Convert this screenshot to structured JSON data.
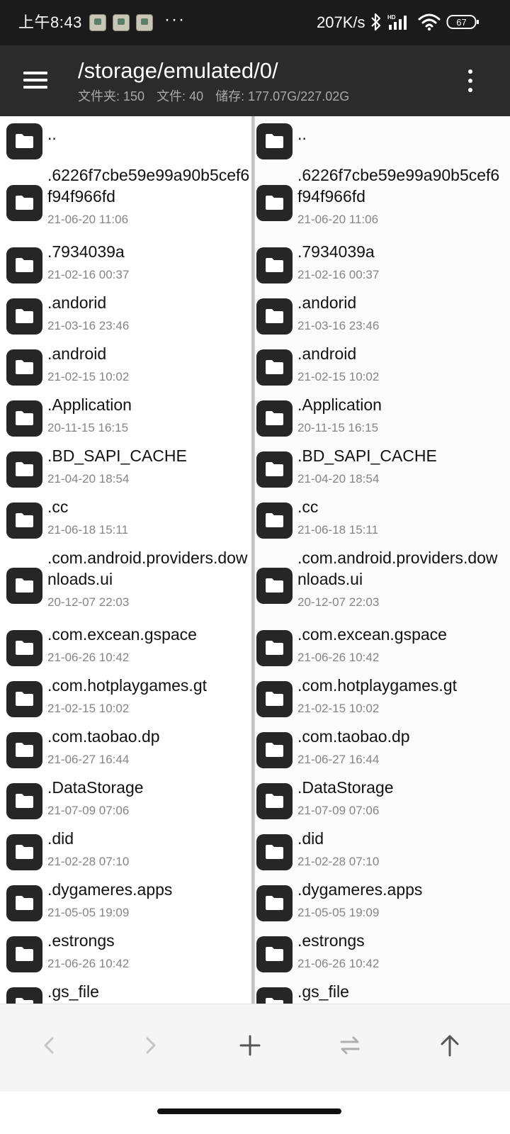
{
  "status_bar": {
    "time": "上午8:43",
    "notification_icons": [
      "app-notification-icon",
      "app-notification-icon",
      "app-notification-icon"
    ],
    "overflow": "···",
    "net_speed": "207K/s",
    "bluetooth_icon": "bluetooth-icon",
    "signal_label": "HD",
    "wifi_icon": "wifi-icon",
    "battery_level": "67"
  },
  "app_bar": {
    "menu_icon": "hamburger-menu-icon",
    "path": "/storage/emulated/0/",
    "folders_label": "文件夹: 150",
    "files_label": "文件: 40",
    "storage_label": "储存: 177.07G/227.02G",
    "overflow_icon": "more-vert-icon"
  },
  "file_list": [
    {
      "name": "..",
      "date": ""
    },
    {
      "name": ".6226f7cbe59e99a90b5cef6f94f966fd",
      "date": "21-06-20 11:06"
    },
    {
      "name": ".7934039a",
      "date": "21-02-16 00:37"
    },
    {
      "name": ".andorid",
      "date": "21-03-16 23:46"
    },
    {
      "name": ".android",
      "date": "21-02-15 10:02"
    },
    {
      "name": ".Application",
      "date": "20-11-15 16:15"
    },
    {
      "name": ".BD_SAPI_CACHE",
      "date": "21-04-20 18:54"
    },
    {
      "name": ".cc",
      "date": "21-06-18 15:11"
    },
    {
      "name": ".com.android.providers.downloads.ui",
      "date": "20-12-07 22:03"
    },
    {
      "name": ".com.excean.gspace",
      "date": "21-06-26 10:42"
    },
    {
      "name": ".com.hotplaygames.gt",
      "date": "21-02-15 10:02"
    },
    {
      "name": ".com.taobao.dp",
      "date": "21-06-27 16:44"
    },
    {
      "name": ".DataStorage",
      "date": "21-07-09 07:06"
    },
    {
      "name": ".did",
      "date": "21-02-28 07:10"
    },
    {
      "name": ".dygameres.apps",
      "date": "21-05-05 19:09"
    },
    {
      "name": ".estrongs",
      "date": "21-06-26 10:42"
    },
    {
      "name": ".gs_file",
      "date": ""
    }
  ],
  "bottom_bar": {
    "back_icon": "chevron-left-icon",
    "forward_icon": "chevron-right-icon",
    "add_icon": "plus-icon",
    "swap_icon": "swap-arrows-icon",
    "up_icon": "arrow-up-icon"
  },
  "colors": {
    "status_bar": "#1b1b1b",
    "app_bar": "#2b2b2b",
    "folder_tile": "#262626",
    "date_text": "#858585",
    "bottom_bar": "#f5f5f5"
  }
}
